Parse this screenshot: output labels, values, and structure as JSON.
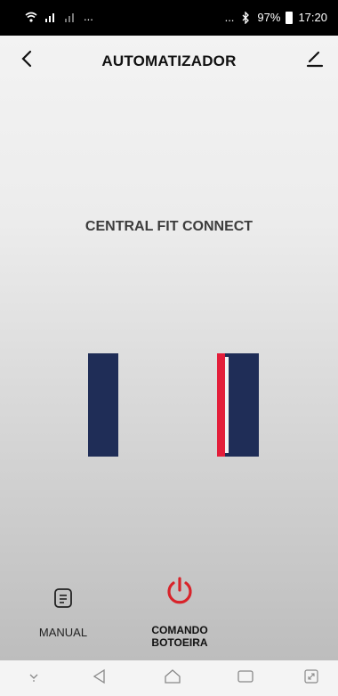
{
  "status_bar": {
    "left_dots": "...",
    "right_dots": "...",
    "battery_percent": "97%",
    "time": "17:20",
    "icons": [
      "wifi-icon",
      "signal-icon",
      "signal-icon-2",
      "bluetooth-icon",
      "battery-icon"
    ]
  },
  "header": {
    "title": "AUTOMATIZADOR",
    "back_icon": "chevron-left-icon",
    "edit_icon": "pencil-icon"
  },
  "device": {
    "name": "CENTRAL FIT CONNECT"
  },
  "actions": [
    {
      "label": "MANUAL",
      "icon": "document-icon"
    },
    {
      "label_line1": "COMANDO",
      "label_line2": "BOTOEIRA",
      "icon": "power-icon"
    }
  ],
  "navbar": {
    "icons": [
      "chevron-down-icon",
      "back-triangle-icon",
      "home-icon",
      "recents-icon",
      "expand-icon"
    ]
  },
  "colors": {
    "gate_blue": "#1f2d57",
    "gate_red": "#e31e3a",
    "power_red": "#d8232a"
  }
}
